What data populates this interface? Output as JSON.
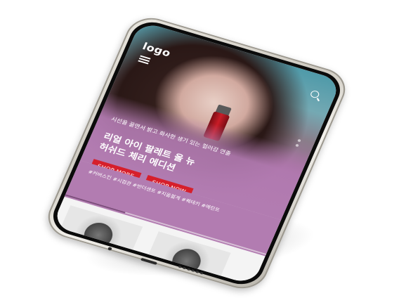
{
  "header": {
    "logo_text": "logo",
    "menu_icon": "hamburger-menu-icon",
    "search_icon": "search-icon"
  },
  "hero": {
    "subtext": "시선을 끌면서 밝고 화사한 생기 있는 컬러감 연출",
    "headline_line1": "리얼 아이 팔레트 올 뉴",
    "headline_line2": "허쉬드 체리 에디션",
    "buttons": [
      {
        "label": "SHOP MORE"
      },
      {
        "label": "SHOP NOW"
      }
    ],
    "tags": "#커버스킨 #시컴관 #반더센트 #지웁젊게 #퀘테키 #예린트",
    "slider_progress_percent": 30
  },
  "colors": {
    "accent_purple": "#b27cb1",
    "button_red": "#d61f2b"
  }
}
